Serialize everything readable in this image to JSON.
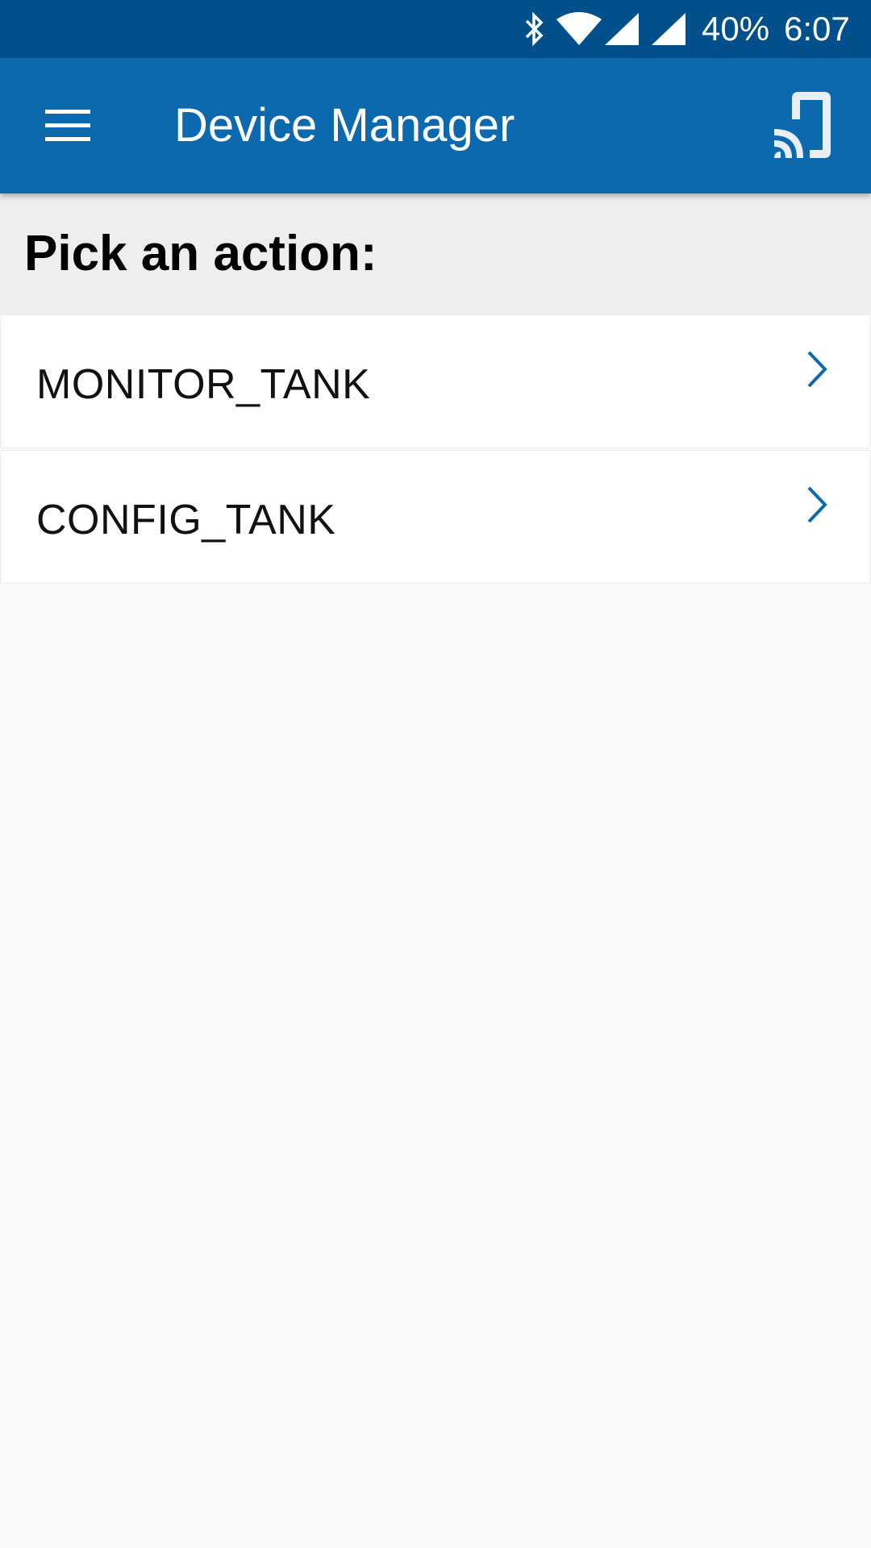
{
  "status_bar": {
    "battery": "40%",
    "time": "6:07",
    "icons": [
      "bluetooth-icon",
      "wifi-icon",
      "signal-icon",
      "signal-icon"
    ]
  },
  "app_bar": {
    "title": "Device Manager",
    "menu_icon": "hamburger-menu-icon",
    "cast_icon": "cast-icon"
  },
  "section": {
    "title": "Pick an action:"
  },
  "actions": [
    {
      "label": "MONITOR_TANK"
    },
    {
      "label": "CONFIG_TANK"
    }
  ],
  "colors": {
    "status_bar": "#014f8b",
    "app_bar": "#0d69ae",
    "accent": "#0d69ae",
    "header_bg": "#eeeeee",
    "page_bg": "#f9f9f9"
  }
}
